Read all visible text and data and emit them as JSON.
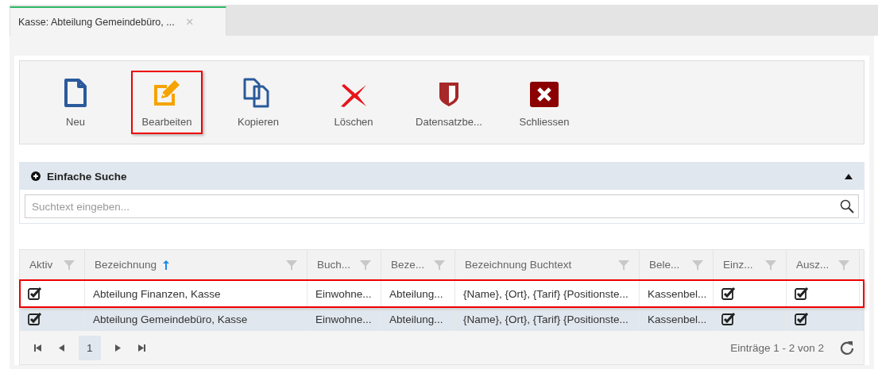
{
  "tabs": [
    {
      "label": "Kasse: Abteilung Gemeindebüro, ...",
      "selected": true,
      "close": "×"
    }
  ],
  "toolbar": [
    {
      "label": "Neu",
      "kind": "document",
      "highlighted": false
    },
    {
      "label": "Bearbeiten",
      "kind": "edit",
      "highlighted": true
    },
    {
      "label": "Kopieren",
      "kind": "copy",
      "highlighted": false
    },
    {
      "label": "Löschen",
      "kind": "delete",
      "highlighted": false
    },
    {
      "label": "Datensatzbe...",
      "kind": "permissions",
      "highlighted": false
    },
    {
      "label": "Schliessen",
      "kind": "close",
      "highlighted": false
    }
  ],
  "search": {
    "title": "Einfache Suche",
    "expanded": true,
    "placeholder": "Suchtext eingeben..."
  },
  "table": {
    "columns": [
      {
        "label": "Aktiv",
        "sorted": false
      },
      {
        "label": "Bezeichnung",
        "sorted": true
      },
      {
        "label": "Buch...",
        "sorted": false
      },
      {
        "label": "Beze...",
        "sorted": false
      },
      {
        "label": "Bezeichnung Buchtext",
        "sorted": false
      },
      {
        "label": "Bele...",
        "sorted": false
      },
      {
        "label": "Einz...",
        "sorted": false
      },
      {
        "label": "Ausz...",
        "sorted": false
      }
    ],
    "rows": [
      {
        "selected": false,
        "highlighted": true,
        "cells": [
          {
            "kind": "checkbox",
            "checked": true
          },
          {
            "kind": "text",
            "text": "Abteilung Finanzen, Kasse"
          },
          {
            "kind": "text",
            "text": "Einwohne..."
          },
          {
            "kind": "text",
            "text": "Abteilung..."
          },
          {
            "kind": "text",
            "text": "{Name}, {Ort}, {Tarif} {Positionste..."
          },
          {
            "kind": "text",
            "text": "Kassenbel..."
          },
          {
            "kind": "checkbox",
            "checked": true
          },
          {
            "kind": "checkbox",
            "checked": true
          }
        ]
      },
      {
        "selected": true,
        "highlighted": false,
        "cells": [
          {
            "kind": "checkbox",
            "checked": true
          },
          {
            "kind": "text",
            "text": "Abteilung Gemeindebüro, Kasse"
          },
          {
            "kind": "text",
            "text": "Einwohne..."
          },
          {
            "kind": "text",
            "text": "Abteilung..."
          },
          {
            "kind": "text",
            "text": "{Name}, {Ort}, {Tarif} {Positionste..."
          },
          {
            "kind": "text",
            "text": "Kassenbel..."
          },
          {
            "kind": "checkbox",
            "checked": true
          },
          {
            "kind": "checkbox",
            "checked": true
          }
        ]
      }
    ]
  },
  "pager": {
    "page": "1",
    "summary": "Einträge 1 - 2 von 2"
  }
}
